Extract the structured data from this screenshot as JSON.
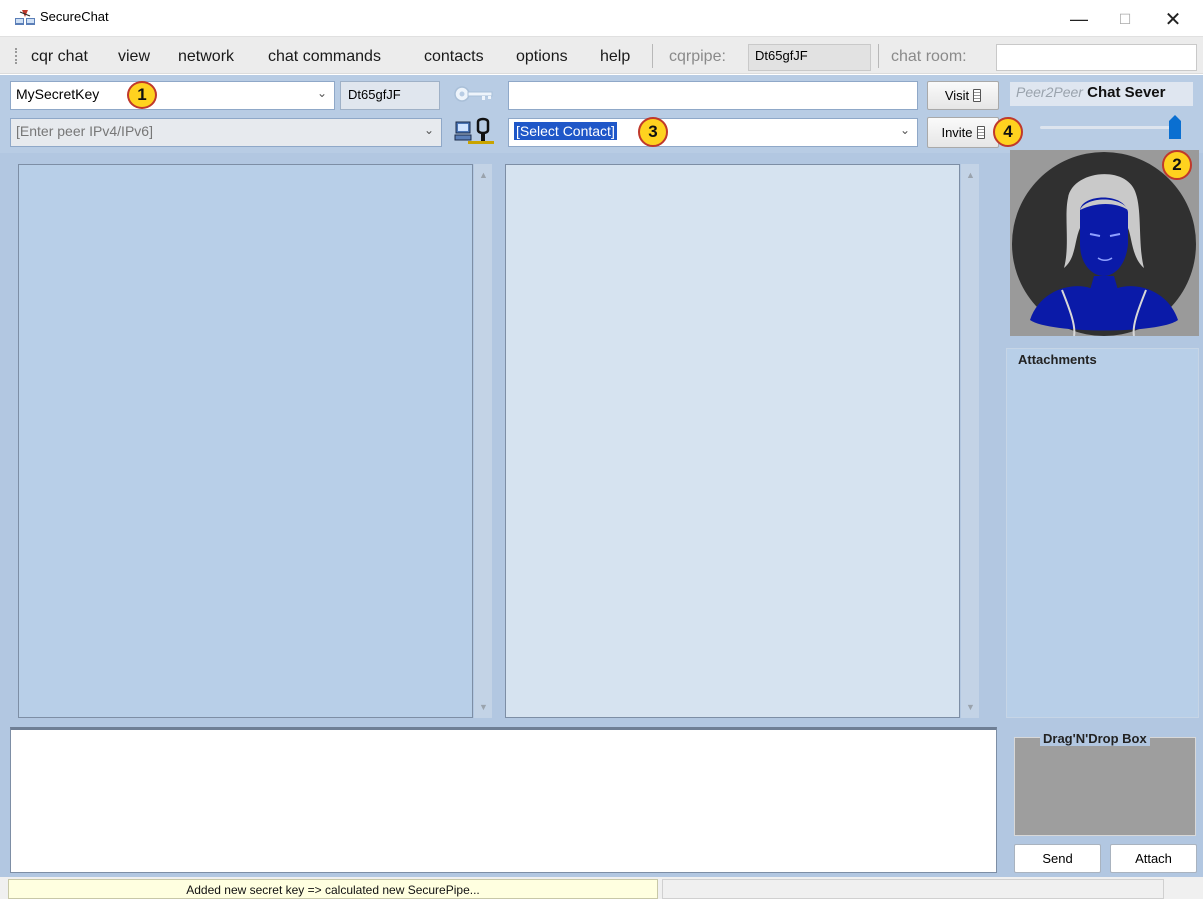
{
  "window": {
    "title": "SecureChat",
    "controls": {
      "minimize": "—",
      "maximize": "☐",
      "close": "✕"
    }
  },
  "menu": {
    "items": [
      "cqr chat",
      "view",
      "network",
      "chat commands",
      "contacts",
      "options",
      "help"
    ],
    "cqrpipe_label": "cqrpipe:",
    "cqrpipe_value": "Dt65gfJF",
    "chatroom_label": "chat room:",
    "chatroom_value": ""
  },
  "toolbar": {
    "secret_key": "MySecretKey",
    "pipe_value": "Dt65gfJF",
    "visit_label": "Visit",
    "peer_placeholder": "[Enter peer IPv4/IPv6]",
    "contact_selected": "[Select Contact]",
    "invite_label": "Invite",
    "mode_p2p": "Peer2Peer",
    "mode_server": "Chat Sever"
  },
  "badges": [
    "1",
    "2",
    "3",
    "4"
  ],
  "side": {
    "attachments_label": "Attachments",
    "dragdrop_label": "Drag'N'Drop Box",
    "send_label": "Send",
    "attach_label": "Attach"
  },
  "status": {
    "message": "Added new secret key => calculated new SecurePipe..."
  },
  "colors": {
    "main_bg": "#b2c7e1",
    "left_pane": "#b8cfe8",
    "right_pane": "#d6e3f0",
    "badge": "#ffd21f",
    "selection": "#1f57c8",
    "avatar_blue": "#0a1aa8"
  },
  "icons": {
    "app": "securechat-app-icon",
    "key": "key-icon",
    "connect": "connect-plug-icon",
    "phone": "phone-icon",
    "slider": "mode-slider-thumb"
  }
}
